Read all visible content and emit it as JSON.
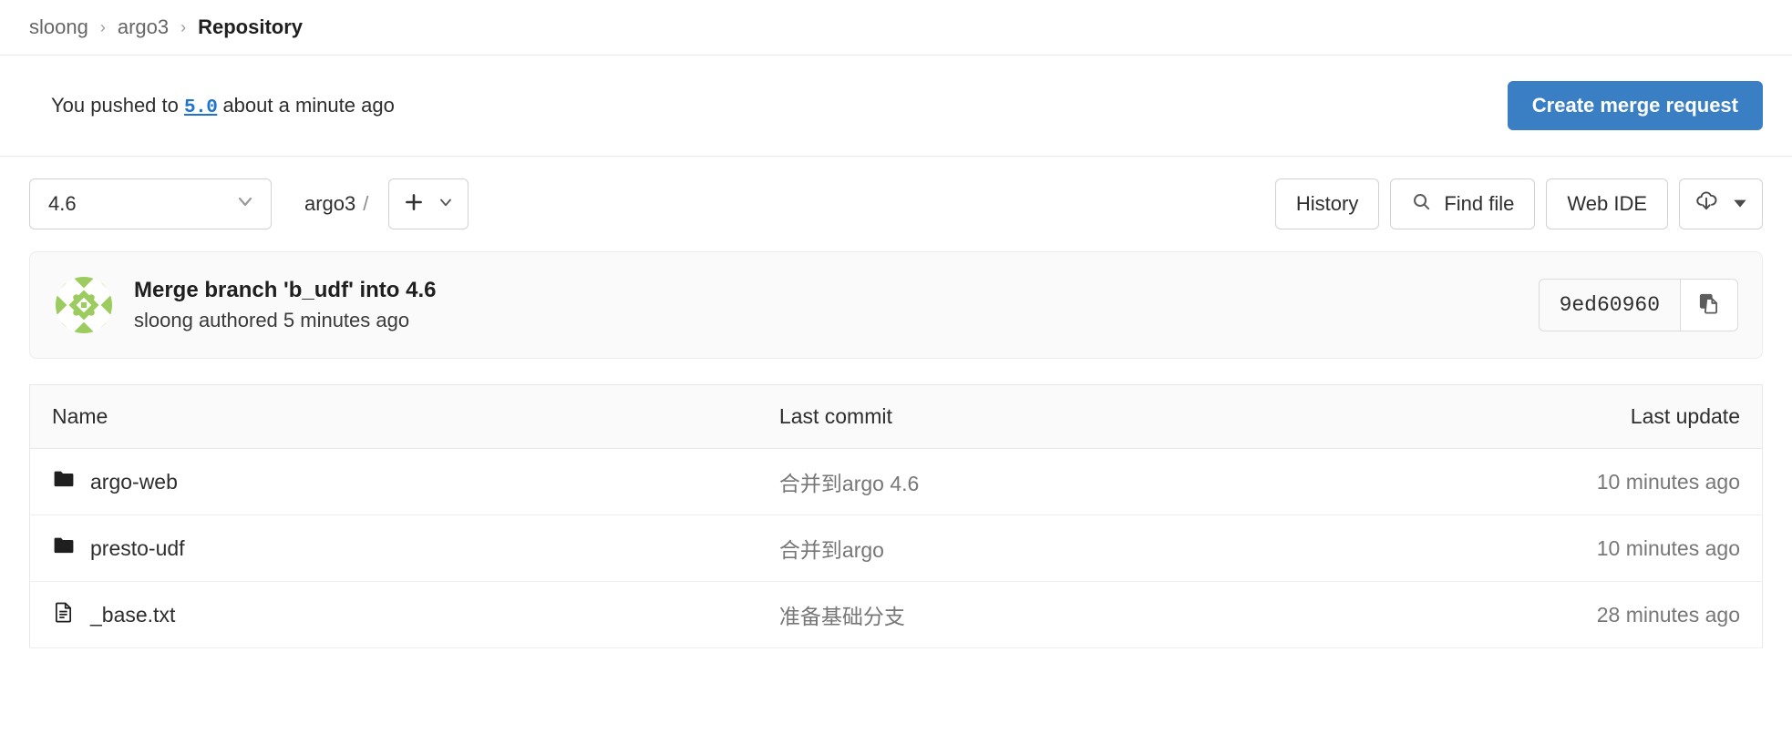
{
  "breadcrumb": {
    "items": [
      {
        "label": "sloong",
        "current": false
      },
      {
        "label": "argo3",
        "current": false
      },
      {
        "label": "Repository",
        "current": true
      }
    ],
    "separator": "›"
  },
  "push_notice": {
    "prefix": "You pushed to",
    "branch": "5.0",
    "suffix": "about a minute ago",
    "action_label": "Create merge request",
    "action_color": "#3a7fc4"
  },
  "toolbar": {
    "branch_selector": {
      "value": "4.6",
      "icon": "chevron-down-icon"
    },
    "path": "argo3",
    "path_separator": "/",
    "add_button": {
      "label": "+",
      "icon": "plus-icon"
    },
    "history_label": "History",
    "find_file_label": "Find file",
    "find_file_icon": "search-icon",
    "web_ide_label": "Web IDE",
    "download_icon": "download-cloud-icon",
    "download_caret": "caret-down-icon"
  },
  "last_commit": {
    "avatar": "identicon-avatar",
    "title": "Merge branch 'b_udf' into 4.6",
    "author_line": "sloong authored 5 minutes ago",
    "sha": "9ed60960",
    "copy_icon": "copy-icon"
  },
  "file_table": {
    "headers": {
      "name": "Name",
      "last_commit": "Last commit",
      "last_update": "Last update"
    },
    "rows": [
      {
        "icon": "folder-icon",
        "name": "argo-web",
        "last_commit": "合并到argo 4.6",
        "last_update": "10 minutes ago"
      },
      {
        "icon": "folder-icon",
        "name": "presto-udf",
        "last_commit": "合并到argo",
        "last_update": "10 minutes ago"
      },
      {
        "icon": "file-icon",
        "name": "_base.txt",
        "last_commit": "准备基础分支",
        "last_update": "28 minutes ago"
      }
    ]
  }
}
